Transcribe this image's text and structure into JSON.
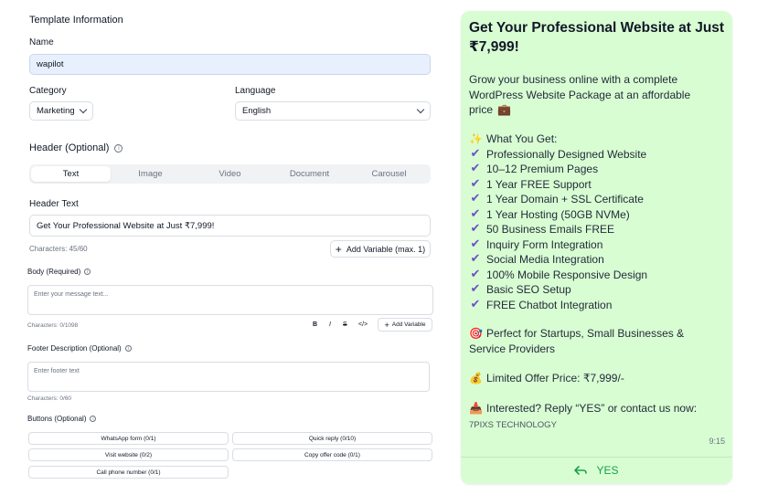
{
  "form": {
    "section_title": "Template Information",
    "name": {
      "label": "Name",
      "value": "wapilot"
    },
    "category": {
      "label": "Category",
      "value": "Marketing"
    },
    "language": {
      "label": "Language",
      "value": "English"
    },
    "header": {
      "label": "Header (Optional)",
      "tabs": [
        "Text",
        "Image",
        "Video",
        "Document",
        "Carousel"
      ],
      "active_tab": "Text",
      "text_label": "Header Text",
      "text_value": "Get Your Professional Website at Just ₹7,999!",
      "char_count": "Characters: 45/60",
      "add_variable": "Add Variable (max. 1)"
    },
    "body": {
      "label": "Body (Required)",
      "placeholder": "Enter your message text...",
      "char_count": "Characters: 0/1098",
      "format_bold": "B",
      "format_italic": "I",
      "format_strike": "S",
      "format_code": "</>",
      "add_variable": "Add Variable"
    },
    "footer": {
      "label": "Footer Description (Optional)",
      "placeholder": "Enter footer text",
      "char_count": "Characters: 0/60"
    },
    "buttons": {
      "label": "Buttons (Optional)",
      "items": [
        "WhatsApp form (0/1)",
        "Quick reply (0/10)",
        "Visit website (0/2)",
        "Copy offer code (0/1)",
        "Call phone number (0/1)"
      ]
    }
  },
  "preview": {
    "title": "Get Your Professional Website at Just ₹7,999!",
    "intro": [
      "Grow your business online with a complete",
      "WordPress Website Package at an affordable",
      "price"
    ],
    "intro_emoji": "💼",
    "what_you_get": "What You Get:",
    "sparkle_emoji": "✨",
    "features": [
      "Professionally Designed Website",
      "10–12 Premium Pages",
      "1 Year FREE Support",
      "1 Year Domain + SSL Certificate",
      "1 Year Hosting (50GB NVMe)",
      "50 Business Emails FREE",
      "Inquiry Form Integration",
      "Social Media Integration",
      "100% Mobile Responsive Design",
      "Basic SEO Setup",
      "FREE Chatbot Integration"
    ],
    "check_mark": "✔",
    "target_emoji": "🎯",
    "perfect_for": [
      "Perfect for Startups, Small Businesses &",
      "Service Providers"
    ],
    "money_emoji": "💰",
    "offer": "Limited Offer Price: ₹7,999/-",
    "inbox_emoji": "📥",
    "interested": "Interested? Reply “YES” or contact us now:",
    "footer": "7PIXS TECHNOLOGY",
    "time": "9:15",
    "reply_label": "YES"
  },
  "colors": {
    "bubble_bg": "#d9fdd3",
    "check": "#6d4fc7",
    "reply_green": "#16a34a",
    "filled_input": "#e8f0fe"
  }
}
